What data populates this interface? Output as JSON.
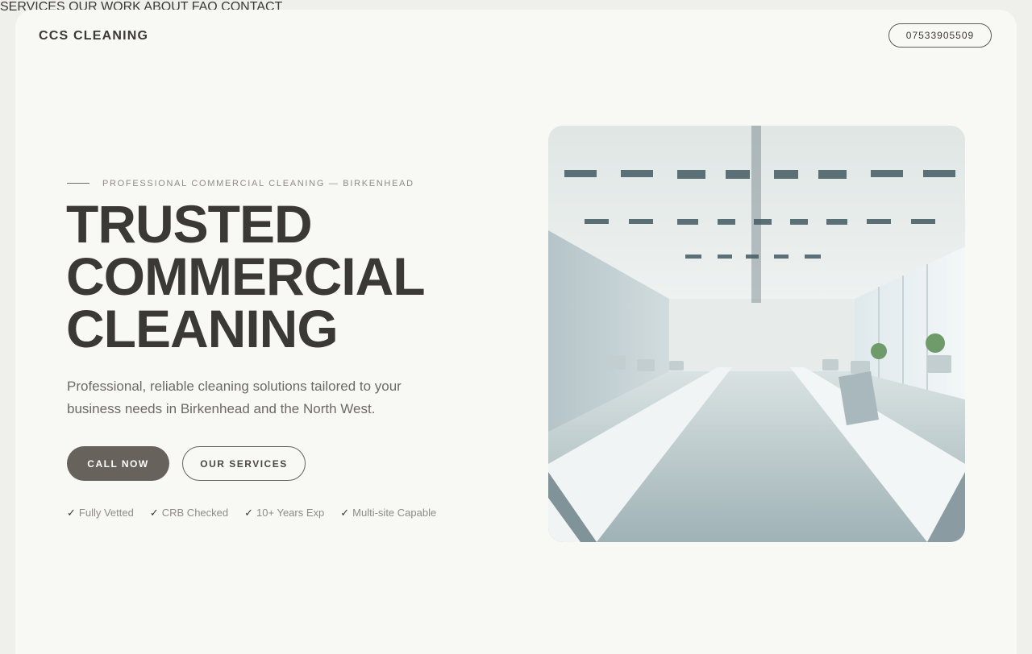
{
  "header": {
    "brand": "CCS CLEANING",
    "nav": [
      "SERVICES",
      "OUR WORK",
      "ABOUT",
      "FAQ",
      "CONTACT"
    ],
    "phone": "07533905509"
  },
  "hero": {
    "eyebrow": "PROFESSIONAL COMMERCIAL CLEANING — BIRKENHEAD",
    "headline": [
      "TRUSTED",
      "COMMERCIAL",
      "CLEANING"
    ],
    "lede": "Professional, reliable cleaning solutions tailored to your business needs in Birkenhead and the North West.",
    "primary_cta": "CALL NOW",
    "secondary_cta": "OUR SERVICES",
    "badges": [
      "Fully Vetted",
      "CRB Checked",
      "10+ Years Exp",
      "Multi-site Capable"
    ],
    "check_glyph": "✓"
  },
  "colors": {
    "page_bg": "#f8f8f5",
    "text_dark": "#3a3935",
    "muted": "#8d8c87",
    "primary_button": "#67625c"
  },
  "icons": {
    "badge_icon": "check-icon"
  }
}
